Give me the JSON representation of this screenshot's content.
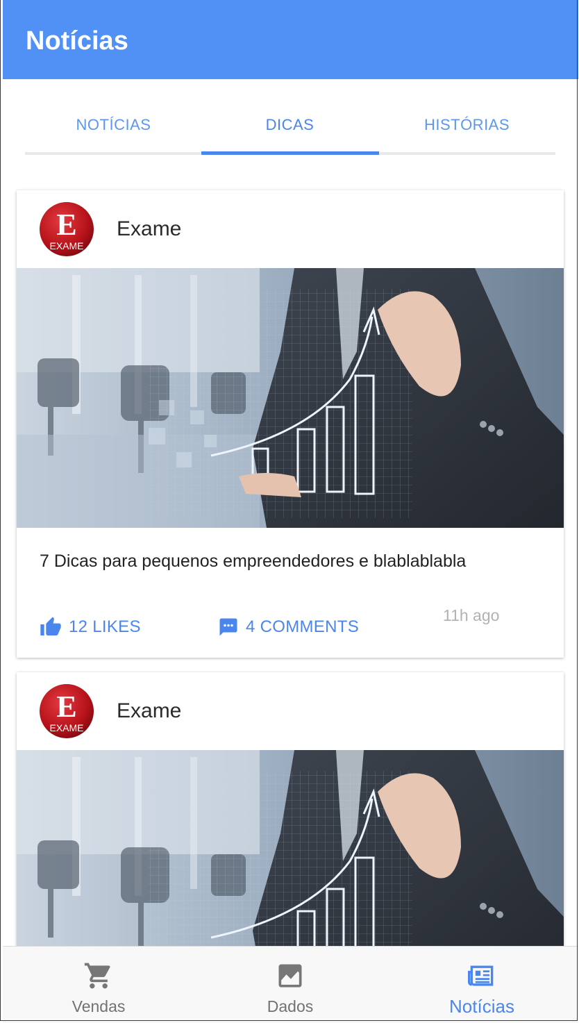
{
  "appbar": {
    "title": "Notícias"
  },
  "tabs": [
    {
      "label": "NOTÍCIAS",
      "active": false
    },
    {
      "label": "DICAS",
      "active": true
    },
    {
      "label": "HISTÓRIAS",
      "active": false
    }
  ],
  "cards": [
    {
      "source": "Exame",
      "avatar_letter": "E",
      "avatar_text": "EXAME",
      "headline": "7 Dicas para pequenos empreendedores e blablablabla",
      "likes": "12 LIKES",
      "comments": "4 COMMENTS",
      "time": "11h ago"
    },
    {
      "source": "Exame",
      "avatar_letter": "E",
      "avatar_text": "EXAME"
    }
  ],
  "bottom_nav": [
    {
      "label": "Vendas",
      "icon": "cart-icon",
      "active": false
    },
    {
      "label": "Dados",
      "icon": "chart-icon",
      "active": false
    },
    {
      "label": "Notícias",
      "icon": "newspaper-icon",
      "active": true
    }
  ],
  "colors": {
    "primary": "#5190f4",
    "accent": "#4a86ec",
    "logo_red": "#c2141b"
  }
}
